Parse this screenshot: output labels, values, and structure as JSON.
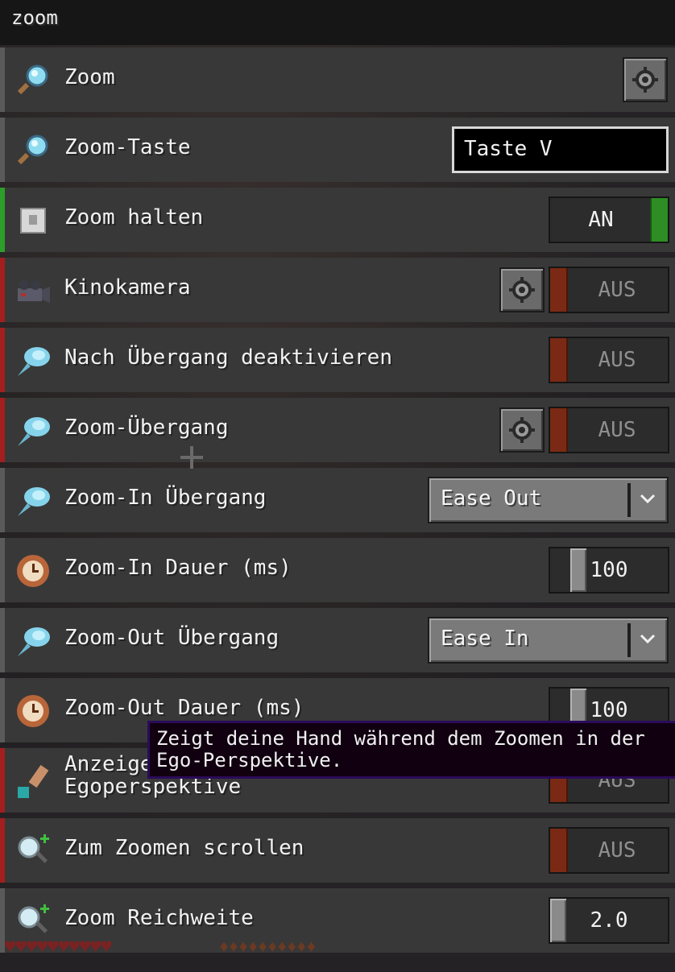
{
  "title": "zoom",
  "rows": [
    {
      "label": "Zoom",
      "icon": "magnifier-icon"
    },
    {
      "label": "Zoom-Taste",
      "icon": "magnifier-icon",
      "key_value": "Taste V"
    },
    {
      "label": "Zoom halten",
      "icon": "paper-icon",
      "toggle": "AN"
    },
    {
      "label": "Kinokamera",
      "icon": "camera-icon",
      "toggle": "AUS"
    },
    {
      "label": "Nach Übergang deaktivieren",
      "icon": "comet-icon",
      "toggle": "AUS"
    },
    {
      "label": "Zoom-Übergang",
      "icon": "comet-icon",
      "toggle": "AUS"
    },
    {
      "label": "Zoom-In Übergang",
      "icon": "comet-icon",
      "dropdown": "Ease Out"
    },
    {
      "label": "Zoom-In Dauer (ms)",
      "icon": "clock-icon",
      "slider_value": "100",
      "slider_fraction": 0.2
    },
    {
      "label": "Zoom-Out Übergang",
      "icon": "comet-icon",
      "dropdown": "Ease In"
    },
    {
      "label": "Zoom-Out Dauer (ms)",
      "icon": "clock-icon",
      "slider_value": "100",
      "slider_fraction": 0.2
    },
    {
      "label": "Anzeigen in der\nEgoperspektive",
      "icon": "arm-icon",
      "toggle": "AUS"
    },
    {
      "label": "Zum Zoomen scrollen",
      "icon": "zoom-plus-icon",
      "toggle": "AUS"
    },
    {
      "label": "Zoom Reichweite",
      "icon": "zoom-plus-icon",
      "slider_value": "2.0",
      "slider_fraction": 0.0
    }
  ],
  "tooltip": "Zeigt deine Hand während dem Zoomen in der\nEgo-Perspektive.",
  "colors": {
    "on": "#2e9e2a",
    "off": "#a31f1f",
    "tooltip_border": "#2a0b5a"
  }
}
